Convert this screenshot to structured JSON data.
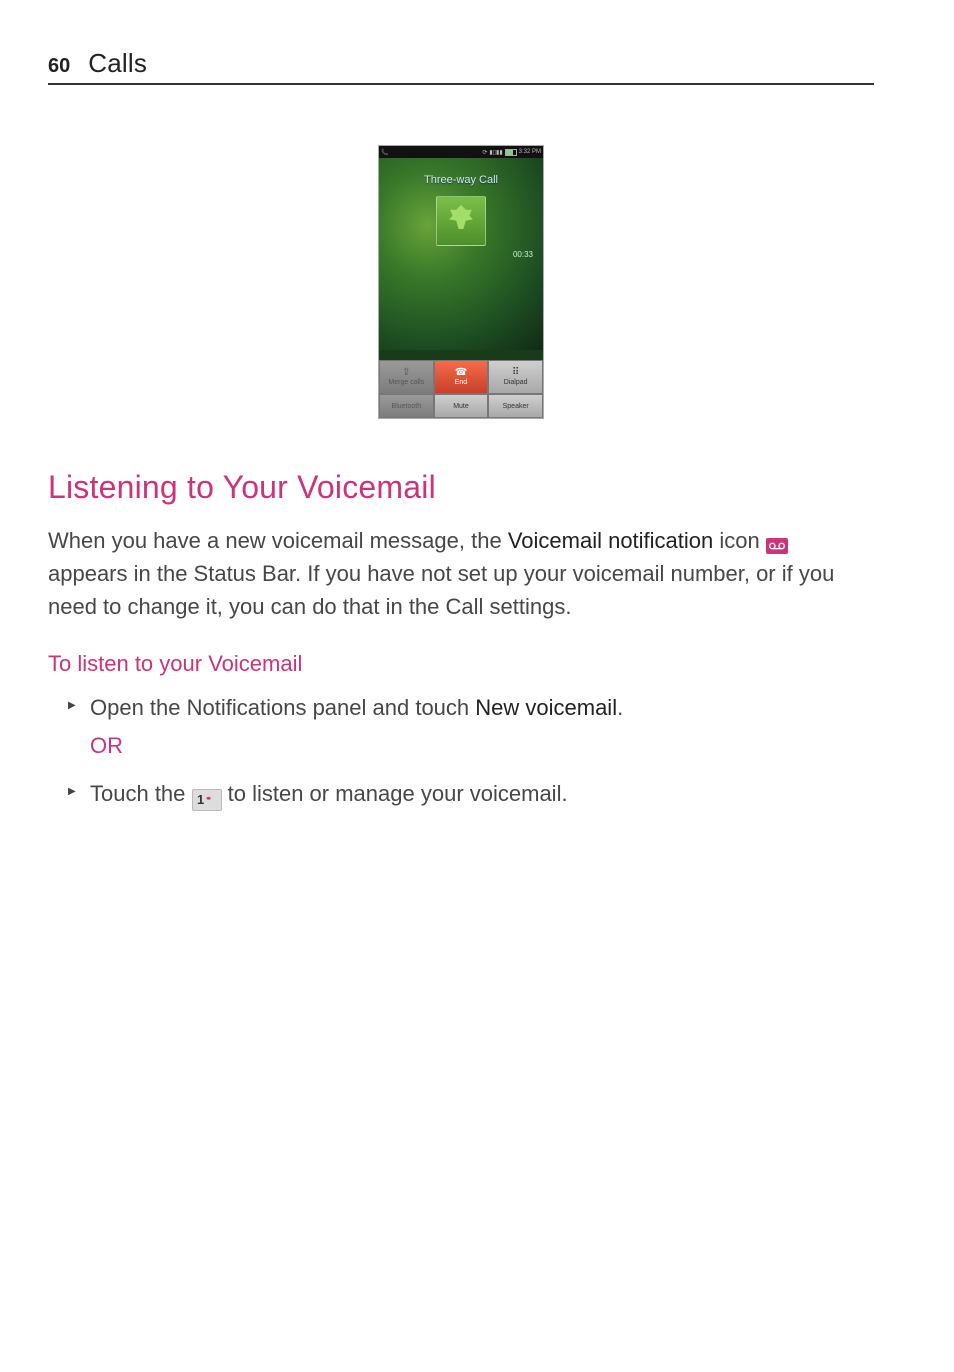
{
  "header": {
    "page_number": "60",
    "section": "Calls"
  },
  "phone": {
    "status_time": "3:32 PM",
    "call_title": "Three-way Call",
    "timer": "00:33",
    "buttons": {
      "merge": "Merge calls",
      "end": "End",
      "dialpad": "Dialpad",
      "bluetooth": "Bluetooth",
      "mute": "Mute",
      "speaker": "Speaker"
    }
  },
  "heading_main": "Listening to Your Voicemail",
  "para1_a": "When you have a new voicemail message, the ",
  "para1_bold": "Voicemail notification",
  "para1_b": " icon ",
  "para1_c": " appears in the Status Bar. If you have not set up your voicemail number, or if you need to change it, you can do that in the Call settings.",
  "subheading": "To listen to your Voicemail",
  "bullet1_a": "Open the Notifications panel and touch ",
  "bullet1_bold": "New voicemail",
  "bullet1_b": ".",
  "or_label": "OR",
  "bullet2_a": "Touch the ",
  "bullet2_key": "1",
  "bullet2_b": " to listen or manage your voicemail."
}
